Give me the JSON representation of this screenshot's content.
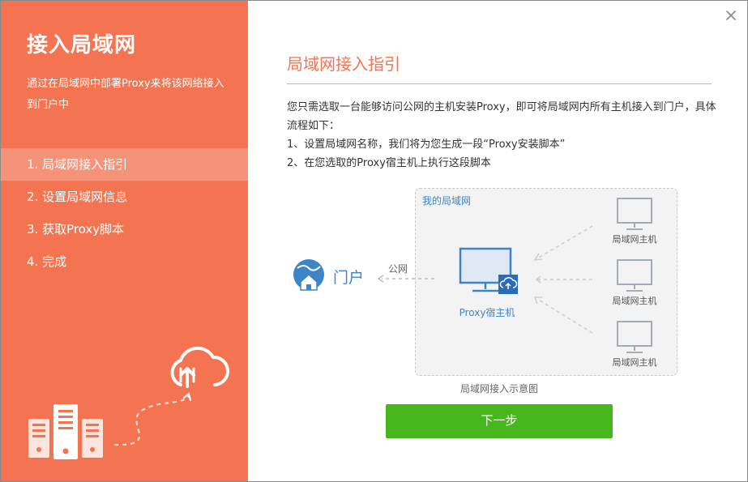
{
  "sidebar": {
    "title": "接入局域网",
    "description": "通过在局域网中部署Proxy来将该网络接入到门户中",
    "steps": [
      {
        "label": "1. 局域网接入指引",
        "active": true
      },
      {
        "label": "2. 设置局域网信息",
        "active": false
      },
      {
        "label": "3. 获取Proxy脚本",
        "active": false
      },
      {
        "label": "4. 完成",
        "active": false
      }
    ],
    "illustration_icons": [
      "cloud-upload-icon",
      "server-icon"
    ]
  },
  "main": {
    "title": "局域网接入指引",
    "intro": [
      "您只需选取一台能够访问公网的主机安装Proxy，即可将局域网内所有主机接入到门户，具体流程如下：",
      "1、设置局域网名称，我们将为您生成一段“Proxy安装脚本”",
      "2、在您选取的Proxy宿主机上执行这段脚本"
    ],
    "diagram": {
      "lan_label": "我的局域网",
      "portal_label": "门户",
      "public_net_label": "公网",
      "proxy_host_label": "Proxy宿主机",
      "lan_hosts": [
        "局域网主机",
        "局域网主机",
        "局域网主机"
      ],
      "caption": "局域网接入示意图"
    },
    "next_button": "下一步"
  },
  "colors": {
    "sidebar_bg": "#f47452",
    "accent_blue": "#3c85c9",
    "primary_button": "#46b81e"
  }
}
